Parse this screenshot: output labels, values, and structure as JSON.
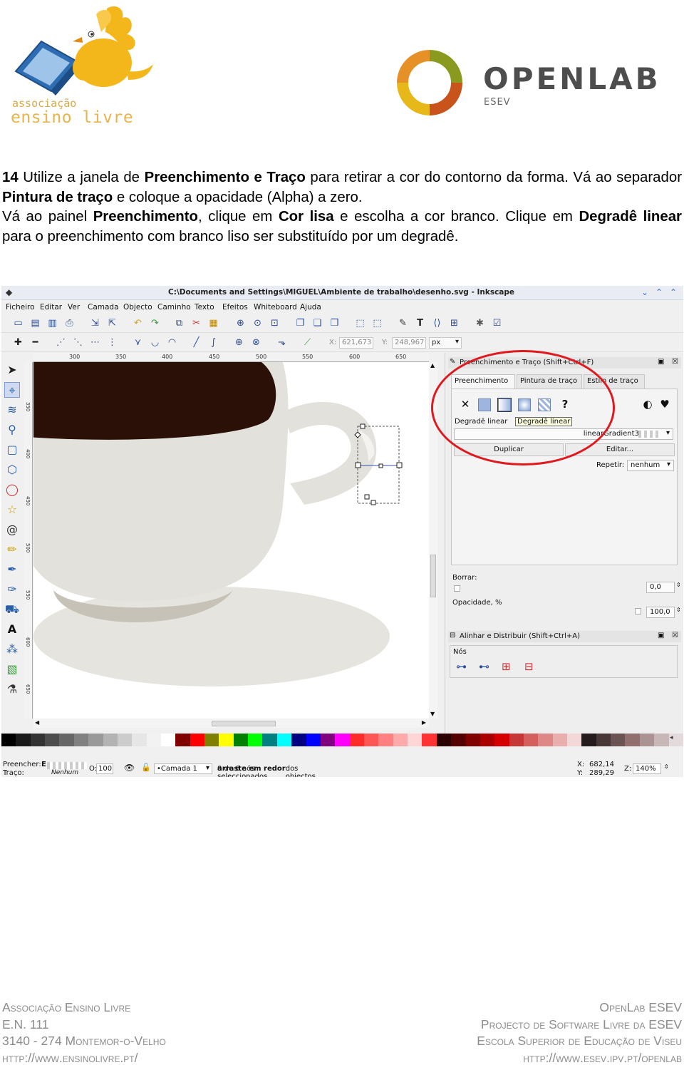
{
  "header": {
    "ael_logo_line1": "associação",
    "ael_logo_line2": "ensino livre",
    "openlab_wordmark": "OPENLAB",
    "openlab_sub": "ESEV"
  },
  "intro": {
    "step_number": "14",
    "p1_a": " Utilize a janela de ",
    "p1_b": "Preenchimento e Traço",
    "p1_c": " para retirar a cor do contorno da forma. Vá ao separador ",
    "p1_d": "Pintura de traço",
    "p1_e": " e coloque a opacidade (Alpha) a zero.",
    "p2_a": "Vá ao painel ",
    "p2_b": "Preenchimento",
    "p2_c": ", clique em ",
    "p2_d": "Cor lisa",
    "p2_e": " e escolha a cor branco. Clique em ",
    "p2_f": "Degradê linear",
    "p2_g": " para o preenchimento com branco liso ser substituído por um degradê."
  },
  "inkscape": {
    "window_title": "C:\\Documents and Settings\\MIGUEL\\Ambiente de trabalho\\desenho.svg - Inkscape",
    "menu": [
      "Ficheiro",
      "Editar",
      "Ver",
      "Camada",
      "Objecto",
      "Caminho",
      "Texto",
      "Efeitos",
      "Whiteboard",
      "Ajuda"
    ],
    "coords": {
      "x_label": "X:",
      "x_value": "621,673",
      "y_label": "Y:",
      "y_value": "248,967",
      "unit": "px"
    },
    "ruler_ticks": [
      "300",
      "350",
      "400",
      "450",
      "500",
      "550",
      "600",
      "650"
    ],
    "ruler_left_ticks": [
      "350",
      "400",
      "450",
      "500",
      "550",
      "600",
      "650",
      "700",
      "750",
      "800",
      "850",
      "900"
    ],
    "fill_stroke": {
      "title": "Preenchimento e Traço (Shift+Ctrl+F)",
      "tabs": [
        "Preenchimento",
        "Pintura de traço",
        "Estilo de traço"
      ],
      "paint_label": "Degradê linear",
      "tooltip": "Degradê linear",
      "none_symbol": "✕",
      "unset_symbol": "?",
      "gradient_name": "linearGradient3243",
      "duplicate_label": "Duplicar",
      "edit_label": "Editar...",
      "repeat_label": "Repetir:",
      "repeat_value": "nenhum",
      "blur_label": "Borrar:",
      "blur_value": "0,0",
      "opacity_label": "Opacidade, %",
      "opacity_value": "100,0"
    },
    "align": {
      "title": "Alinhar e Distribuir (Shift+Ctrl+A)",
      "nodes_label": "Nós"
    },
    "status": {
      "fill_label": "Preencher:",
      "fill_value": "E",
      "stroke_label": "Traço:",
      "stroke_value": "Nenhum",
      "o_label": "O:",
      "o_value": "100",
      "layer": "•Camada 1",
      "message_a": "0 de 6 nós seleccionados. Clique, clique + shift ou ",
      "message_b": "arraste em redor",
      "message_c": " dos objectos para seleccionar.",
      "x_label": "X:",
      "x_value": "682,14",
      "y_label": "Y:",
      "y_value": "289,29",
      "zoom_label": "Z:",
      "zoom_value": "140%"
    },
    "palette": [
      "#000000",
      "#1a1a1a",
      "#333333",
      "#4d4d4d",
      "#666666",
      "#808080",
      "#999999",
      "#b3b3b3",
      "#cccccc",
      "#e6e6e6",
      "#f2f2f2",
      "#ffffff",
      "#800000",
      "#ff0000",
      "#808000",
      "#ffff00",
      "#008000",
      "#00ff00",
      "#008080",
      "#00ffff",
      "#000080",
      "#0000ff",
      "#800080",
      "#ff00ff",
      "#ff2a2a",
      "#ff5555",
      "#ff8080",
      "#ffaaaa",
      "#ffd5d5",
      "#ff3333",
      "#2b0000",
      "#550000",
      "#800000",
      "#aa0000",
      "#d40000",
      "#c83737",
      "#d35f5f",
      "#de8787",
      "#e9afaf",
      "#f4d7d7",
      "#241c1c",
      "#483737",
      "#6c5353",
      "#916f6f",
      "#ac9393",
      "#c8b7b7",
      "#e3dbdb"
    ]
  },
  "footer": {
    "left": [
      "Associação Ensino Livre",
      "E.N. 111",
      "3140 - 274 Montemor-o-Velho",
      "http://www.ensinolivre.pt/"
    ],
    "right": [
      "OpenLab ESEV",
      "Projecto de Software Livre da ESEV",
      "Escola Superior de Educação de Viseu",
      "http://www.esev.ipv.pt/openlab"
    ]
  }
}
